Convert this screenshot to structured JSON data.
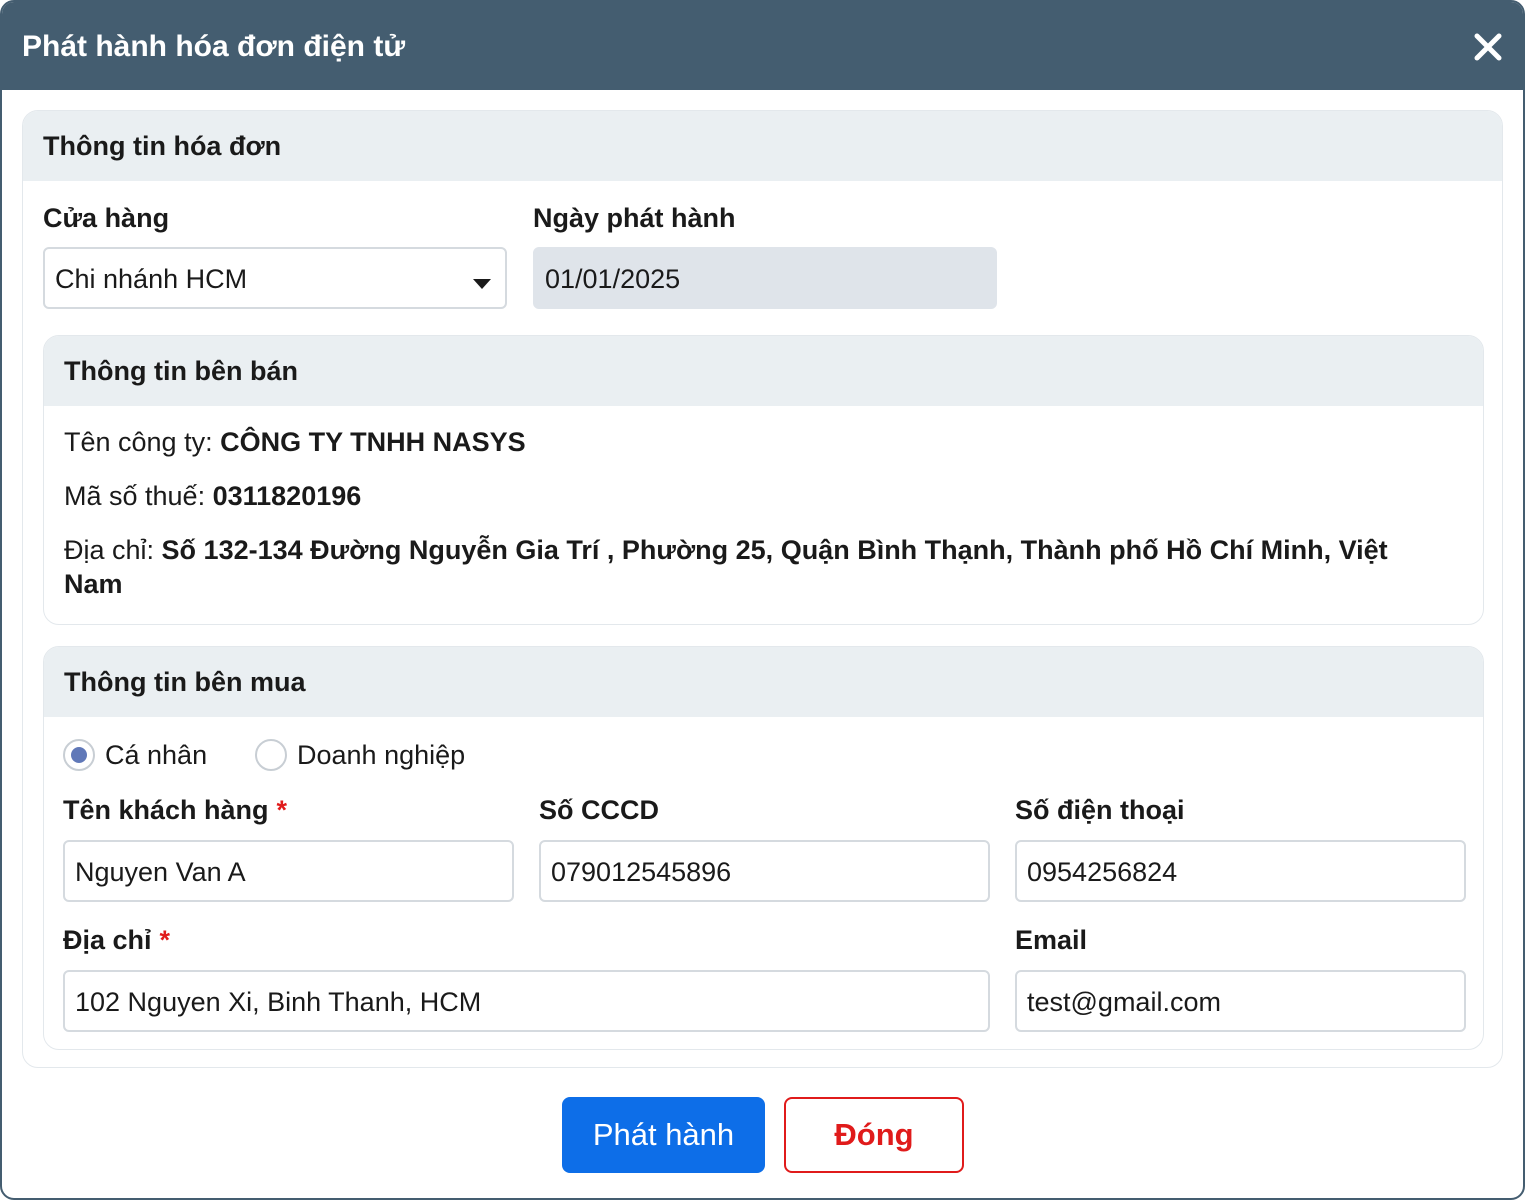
{
  "dialog": {
    "title": "Phát hành hóa đơn điện tử",
    "close_icon": "close-icon"
  },
  "invoice_info": {
    "section_title": "Thông tin hóa đơn",
    "store_label": "Cửa hàng",
    "store_value": "Chi nhánh HCM",
    "issue_date_label": "Ngày phát hành",
    "issue_date_value": "01/01/2025"
  },
  "seller": {
    "section_title": "Thông tin bên bán",
    "company_label": "Tên công ty: ",
    "company_value": "CÔNG TY TNHH NASYS",
    "tax_label": "Mã số thuế: ",
    "tax_value": "0311820196",
    "address_label": "Địa chỉ: ",
    "address_value": "Số 132-134 Đường Nguyễn Gia Trí , Phường 25, Quận Bình Thạnh, Thành phố Hồ Chí Minh, Việt Nam"
  },
  "buyer": {
    "section_title": "Thông tin bên mua",
    "type_options": [
      {
        "label": "Cá nhân",
        "checked": true
      },
      {
        "label": "Doanh nghiệp",
        "checked": false
      }
    ],
    "name_label": "Tên khách hàng",
    "name_value": "Nguyen Van A",
    "required_mark": "*",
    "id_label": "Số CCCD",
    "id_value": "079012545896",
    "phone_label": "Số điện thoại",
    "phone_value": "0954256824",
    "address_label": "Địa chỉ",
    "address_value": "102 Nguyen Xi, Binh Thanh, HCM",
    "email_label": "Email",
    "email_value": "test@gmail.com"
  },
  "actions": {
    "issue_label": "Phát hành",
    "close_label": "Đóng"
  },
  "colors": {
    "header": "#445d70",
    "primary": "#0d6ee8",
    "danger": "#e01b1b",
    "section_header": "#eaeff2"
  }
}
